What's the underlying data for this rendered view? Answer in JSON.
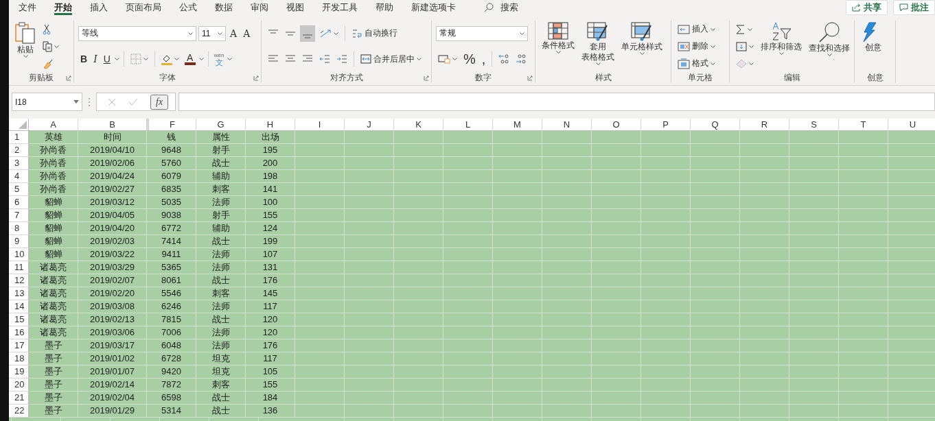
{
  "menu_tabs": [
    {
      "label": "文件",
      "selected": false
    },
    {
      "label": "开始",
      "selected": true
    },
    {
      "label": "插入",
      "selected": false
    },
    {
      "label": "页面布局",
      "selected": false
    },
    {
      "label": "公式",
      "selected": false
    },
    {
      "label": "数据",
      "selected": false
    },
    {
      "label": "审阅",
      "selected": false
    },
    {
      "label": "视图",
      "selected": false
    },
    {
      "label": "开发工具",
      "selected": false
    },
    {
      "label": "帮助",
      "selected": false
    },
    {
      "label": "新建选项卡",
      "selected": false
    }
  ],
  "search": {
    "label": "搜索"
  },
  "share_button": "共享",
  "comment_button": "批注",
  "ribbon": [
    {
      "kind": "clipboard",
      "title": "剪贴板",
      "paste": "粘贴"
    },
    {
      "kind": "font",
      "title": "字体",
      "font_name": "等线",
      "font_size": "11",
      "grow": "A",
      "shrink": "A",
      "styles": [
        "B",
        "I",
        "U"
      ],
      "font_color": "A",
      "phonetic_top": "wén",
      "phonetic_bottom": "文"
    },
    {
      "kind": "alignment",
      "title": "对齐方式",
      "vertical": [
        {
          "selected": false
        },
        {
          "selected": false
        },
        {
          "selected": true
        }
      ],
      "wrap": "自动换行",
      "merge": "合并后居中"
    },
    {
      "kind": "number",
      "title": "数字",
      "format": "常规",
      "percent": "%",
      "comma": ","
    },
    {
      "kind": "styles",
      "title": "样式",
      "buttons": [
        {
          "lines": [
            "条件格式"
          ]
        },
        {
          "lines": [
            "套用",
            "表格格式"
          ]
        },
        {
          "lines": [
            "单元格样式"
          ]
        }
      ]
    },
    {
      "kind": "cells",
      "title": "单元格",
      "buttons": [
        {
          "label": "插入"
        },
        {
          "label": "删除"
        },
        {
          "label": "格式"
        }
      ]
    },
    {
      "kind": "editing",
      "title": "编辑",
      "sort": "排序和筛选",
      "find": "查找和选择"
    },
    {
      "kind": "ideas",
      "title": "创意",
      "label": "创意"
    }
  ],
  "formula_bar": {
    "name_box": "I18",
    "fx": "fx"
  },
  "columns": [
    {
      "letter": "A",
      "hidden_before": false
    },
    {
      "letter": "B",
      "hidden_before": false
    },
    {
      "letter": "F",
      "hidden_before": true
    },
    {
      "letter": "G",
      "hidden_before": false
    },
    {
      "letter": "H",
      "hidden_before": false
    },
    {
      "letter": "I",
      "hidden_before": false
    },
    {
      "letter": "J",
      "hidden_before": false
    },
    {
      "letter": "K",
      "hidden_before": false
    },
    {
      "letter": "L",
      "hidden_before": false
    },
    {
      "letter": "M",
      "hidden_before": false
    },
    {
      "letter": "N",
      "hidden_before": false
    },
    {
      "letter": "O",
      "hidden_before": false
    },
    {
      "letter": "P",
      "hidden_before": false
    },
    {
      "letter": "Q",
      "hidden_before": false
    },
    {
      "letter": "R",
      "hidden_before": false
    },
    {
      "letter": "S",
      "hidden_before": false
    },
    {
      "letter": "T",
      "hidden_before": false
    },
    {
      "letter": "U",
      "hidden_before": false
    }
  ],
  "rows": [
    {
      "number": "1",
      "cells": [
        "英雄",
        "时间",
        "钱",
        "属性",
        "出场"
      ]
    },
    {
      "number": "2",
      "cells": [
        "孙尚香",
        "2019/04/10",
        "9648",
        "射手",
        "195"
      ]
    },
    {
      "number": "3",
      "cells": [
        "孙尚香",
        "2019/02/06",
        "5760",
        "战士",
        "200"
      ]
    },
    {
      "number": "4",
      "cells": [
        "孙尚香",
        "2019/04/24",
        "6079",
        "辅助",
        "198"
      ]
    },
    {
      "number": "5",
      "cells": [
        "孙尚香",
        "2019/02/27",
        "6835",
        "刺客",
        "141"
      ]
    },
    {
      "number": "6",
      "cells": [
        "貂蝉",
        "2019/03/12",
        "5035",
        "法师",
        "100"
      ]
    },
    {
      "number": "7",
      "cells": [
        "貂蝉",
        "2019/04/05",
        "9038",
        "射手",
        "155"
      ]
    },
    {
      "number": "8",
      "cells": [
        "貂蝉",
        "2019/04/20",
        "6772",
        "辅助",
        "124"
      ]
    },
    {
      "number": "9",
      "cells": [
        "貂蝉",
        "2019/02/03",
        "7414",
        "战士",
        "199"
      ]
    },
    {
      "number": "10",
      "cells": [
        "貂蝉",
        "2019/03/22",
        "9411",
        "法师",
        "107"
      ]
    },
    {
      "number": "11",
      "cells": [
        "诸葛亮",
        "2019/03/29",
        "5365",
        "法师",
        "131"
      ]
    },
    {
      "number": "12",
      "cells": [
        "诸葛亮",
        "2019/02/07",
        "8061",
        "战士",
        "176"
      ]
    },
    {
      "number": "13",
      "cells": [
        "诸葛亮",
        "2019/02/20",
        "5546",
        "刺客",
        "145"
      ]
    },
    {
      "number": "14",
      "cells": [
        "诸葛亮",
        "2019/03/08",
        "6246",
        "法师",
        "117"
      ]
    },
    {
      "number": "15",
      "cells": [
        "诸葛亮",
        "2019/02/13",
        "7815",
        "战士",
        "120"
      ]
    },
    {
      "number": "16",
      "cells": [
        "诸葛亮",
        "2019/03/06",
        "7006",
        "法师",
        "120"
      ]
    },
    {
      "number": "17",
      "cells": [
        "墨子",
        "2019/03/17",
        "6048",
        "法师",
        "176"
      ]
    },
    {
      "number": "18",
      "cells": [
        "墨子",
        "2019/01/02",
        "6728",
        "坦克",
        "117"
      ]
    },
    {
      "number": "19",
      "cells": [
        "墨子",
        "2019/01/07",
        "9420",
        "坦克",
        "105"
      ]
    },
    {
      "number": "20",
      "cells": [
        "墨子",
        "2019/02/14",
        "7872",
        "刺客",
        "155"
      ]
    },
    {
      "number": "21",
      "cells": [
        "墨子",
        "2019/02/04",
        "6598",
        "战士",
        "184"
      ]
    },
    {
      "number": "22",
      "cells": [
        "墨子",
        "2019/01/29",
        "5314",
        "战士",
        "136"
      ]
    }
  ]
}
